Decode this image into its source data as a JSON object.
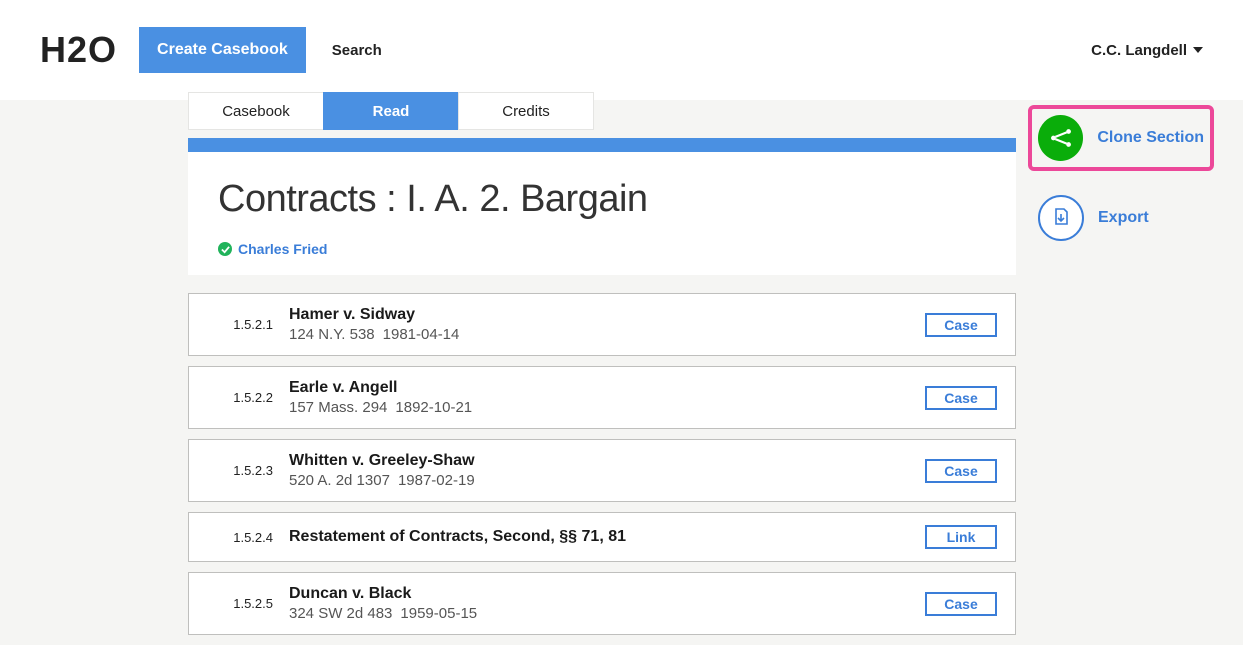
{
  "header": {
    "logo": "H2O",
    "create_label": "Create Casebook",
    "search_label": "Search",
    "user_name": "C.C. Langdell"
  },
  "tabs": [
    {
      "label": "Casebook",
      "active": false
    },
    {
      "label": "Read",
      "active": true
    },
    {
      "label": "Credits",
      "active": false
    }
  ],
  "section": {
    "title": "Contracts : I. A. 2. Bargain",
    "author": "Charles Fried"
  },
  "actions": {
    "clone_label": "Clone Section",
    "export_label": "Export"
  },
  "items": [
    {
      "num": "1.5.2.1",
      "title": "Hamer v. Sidway",
      "citation": "124 N.Y. 538",
      "date": "1981-04-14",
      "badge": "Case"
    },
    {
      "num": "1.5.2.2",
      "title": "Earle v. Angell",
      "citation": "157 Mass. 294",
      "date": "1892-10-21",
      "badge": "Case"
    },
    {
      "num": "1.5.2.3",
      "title": "Whitten v. Greeley-Shaw",
      "citation": "520 A. 2d 1307",
      "date": "1987-02-19",
      "badge": "Case"
    },
    {
      "num": "1.5.2.4",
      "title": "Restatement of Contracts, Second, §§ 71, 81",
      "citation": "",
      "date": "",
      "badge": "Link"
    },
    {
      "num": "1.5.2.5",
      "title": "Duncan v. Black",
      "citation": "324 SW 2d 483",
      "date": "1959-05-15",
      "badge": "Case"
    }
  ]
}
